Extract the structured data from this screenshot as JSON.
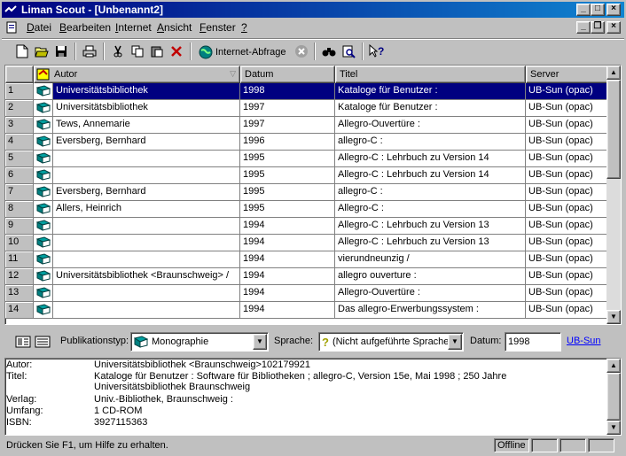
{
  "window": {
    "title": "Liman Scout - [Unbenannt2]"
  },
  "menu": [
    "Datei",
    "Bearbeiten",
    "Internet",
    "Ansicht",
    "Fenster",
    "?"
  ],
  "menu_accel": [
    "D",
    "B",
    "I",
    "A",
    "F",
    "?"
  ],
  "toolbar": {
    "internet_query_label": "Internet-Abfrage"
  },
  "grid": {
    "columns": [
      "Autor",
      "Datum",
      "Titel",
      "Server"
    ],
    "rows": [
      {
        "num": "1",
        "autor": "Universitätsbibliothek",
        "datum": "1998",
        "titel": "Kataloge für Benutzer :",
        "server": "UB-Sun (opac)",
        "selected": true
      },
      {
        "num": "2",
        "autor": "Universitätsbibliothek",
        "datum": "1997",
        "titel": "Kataloge für Benutzer :",
        "server": "UB-Sun (opac)"
      },
      {
        "num": "3",
        "autor": "Tews, Annemarie",
        "datum": "1997",
        "titel": "Allegro-Ouvertüre :",
        "server": "UB-Sun (opac)"
      },
      {
        "num": "4",
        "autor": "Eversberg, Bernhard",
        "datum": "1996",
        "titel": "allegro-C :",
        "server": "UB-Sun (opac)"
      },
      {
        "num": "5",
        "autor": "",
        "datum": "1995",
        "titel": "Allegro-C : Lehrbuch zu Version 14",
        "server": "UB-Sun (opac)"
      },
      {
        "num": "6",
        "autor": "",
        "datum": "1995",
        "titel": "Allegro-C : Lehrbuch zu Version 14",
        "server": "UB-Sun (opac)"
      },
      {
        "num": "7",
        "autor": "Eversberg, Bernhard",
        "datum": "1995",
        "titel": "allegro-C :",
        "server": "UB-Sun (opac)"
      },
      {
        "num": "8",
        "autor": "Allers, Heinrich",
        "datum": "1995",
        "titel": "Allegro-C :",
        "server": "UB-Sun (opac)"
      },
      {
        "num": "9",
        "autor": "",
        "datum": "1994",
        "titel": "Allegro-C : Lehrbuch zu Version 13",
        "server": "UB-Sun (opac)"
      },
      {
        "num": "10",
        "autor": "",
        "datum": "1994",
        "titel": "Allegro-C : Lehrbuch zu Version 13",
        "server": "UB-Sun (opac)"
      },
      {
        "num": "11",
        "autor": "",
        "datum": "1994",
        "titel": "vierundneunzig /",
        "server": "UB-Sun (opac)"
      },
      {
        "num": "12",
        "autor": "Universitätsbibliothek <Braunschweig> /",
        "datum": "1994",
        "titel": "allegro ouverture :",
        "server": "UB-Sun (opac)"
      },
      {
        "num": "13",
        "autor": "",
        "datum": "1994",
        "titel": "Allegro-Ouvertüre :",
        "server": "UB-Sun (opac)"
      },
      {
        "num": "14",
        "autor": "",
        "datum": "1994",
        "titel": "Das allegro-Erwerbungssystem :",
        "server": "UB-Sun (opac)"
      }
    ]
  },
  "filter": {
    "pubtype_label": "Publikationstyp:",
    "pubtype_value": "Monographie",
    "language_label": "Sprache:",
    "language_value": "(Nicht aufgeführte Sprache)",
    "date_label": "Datum:",
    "date_value": "1998",
    "server_link": "UB-Sun"
  },
  "details": [
    {
      "label": "Autor:",
      "value": "Universitätsbibliothek <Braunschweig>102179921"
    },
    {
      "label": "Titel:",
      "value": "Kataloge für Benutzer : Software für Bibliotheken ; allegro-C, Version 15e, Mai 1998 ; 250 Jahre Universitätsbibliothek Braunschweig"
    },
    {
      "label": "Verlag:",
      "value": "Univ.-Bibliothek, Braunschweig :"
    },
    {
      "label": "Umfang:",
      "value": "1 CD-ROM"
    },
    {
      "label": "ISBN:",
      "value": "3927115363"
    }
  ],
  "status": {
    "message": "Drücken Sie F1, um Hilfe zu erhalten.",
    "offline": "Offline"
  },
  "colors": {
    "selection": "#000080",
    "face": "#c0c0c0",
    "book": "#008080"
  }
}
